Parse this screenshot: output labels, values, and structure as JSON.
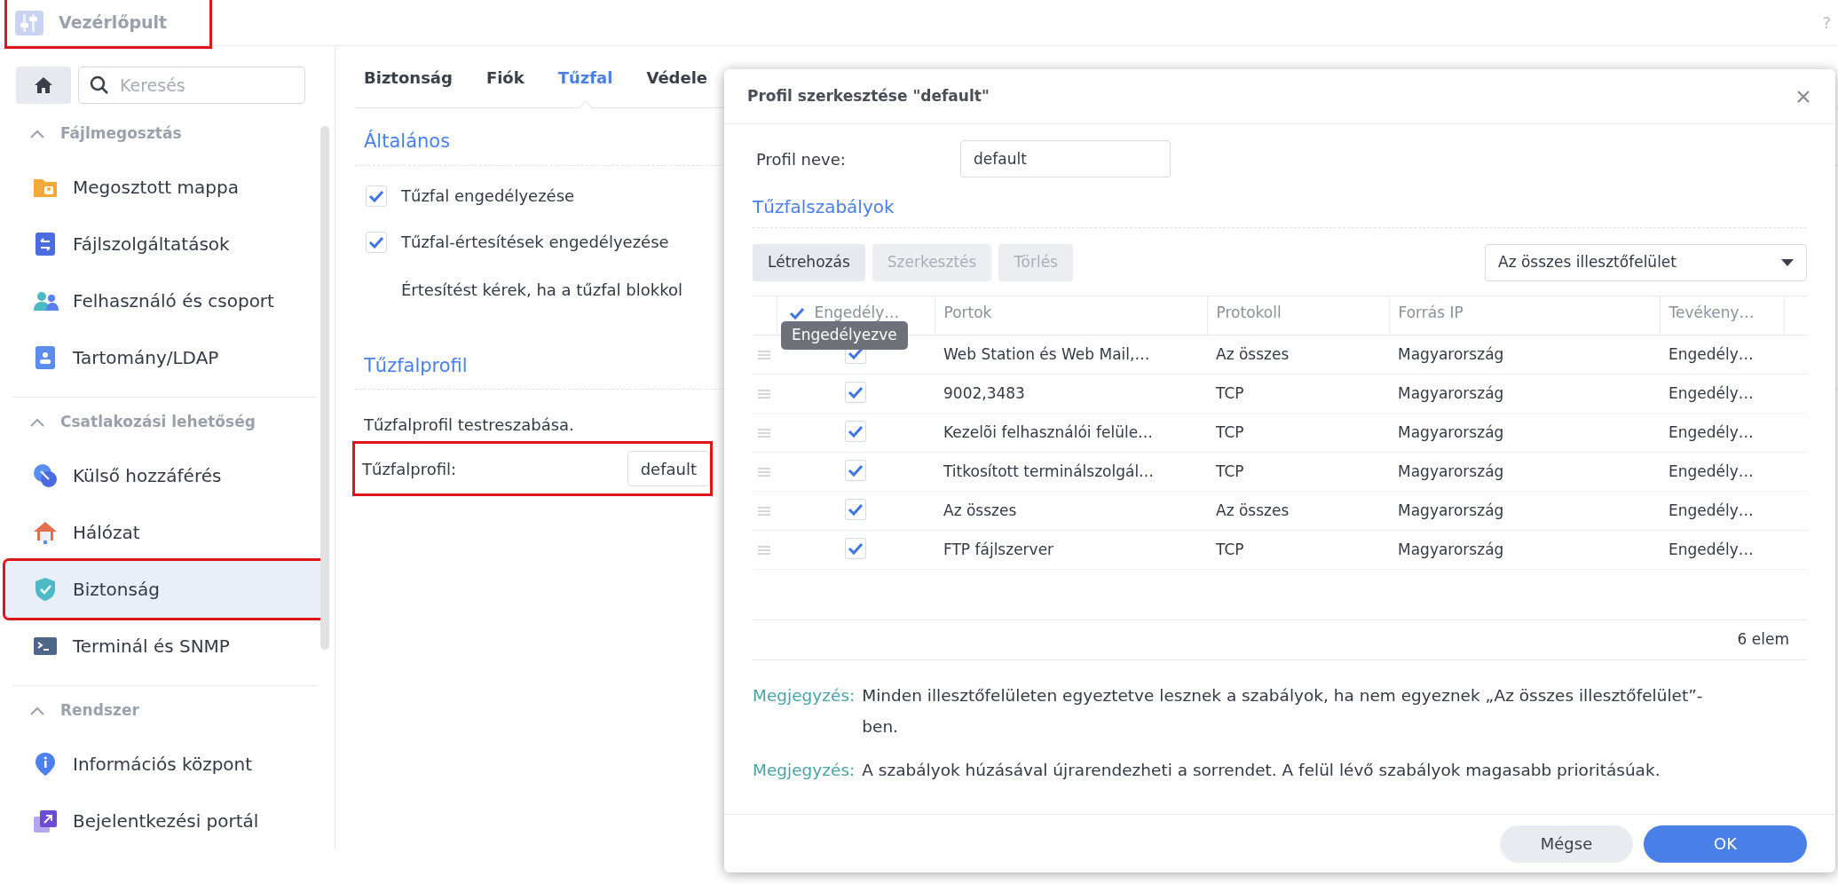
{
  "app": {
    "title": "Vezérlőpult",
    "highlight": true,
    "help": "?"
  },
  "sidebar": {
    "search": {
      "placeholder": "Keresés"
    },
    "groups": [
      {
        "label": "Fájlmegosztás",
        "expanded": true,
        "items": [
          {
            "label": "Megosztott mappa",
            "selected": false,
            "highlight": false
          },
          {
            "label": "Fájlszolgáltatások",
            "selected": false,
            "highlight": false
          },
          {
            "label": "Felhasználó és csoport",
            "selected": false,
            "highlight": false
          },
          {
            "label": "Tartomány/LDAP",
            "selected": false,
            "highlight": false
          }
        ]
      },
      {
        "label": "Csatlakozási lehetőség",
        "expanded": true,
        "items": [
          {
            "label": "Külső hozzáférés",
            "selected": false,
            "highlight": false
          },
          {
            "label": "Hálózat",
            "selected": false,
            "highlight": false
          },
          {
            "label": "Biztonság",
            "selected": true,
            "highlight": true
          },
          {
            "label": "Terminál és SNMP",
            "selected": false,
            "highlight": false
          }
        ]
      },
      {
        "label": "Rendszer",
        "expanded": true,
        "items": [
          {
            "label": "Információs központ",
            "selected": false,
            "highlight": false
          },
          {
            "label": "Bejelentkezési portál",
            "selected": false,
            "highlight": false
          }
        ]
      }
    ]
  },
  "main": {
    "tabs": [
      {
        "label": "Biztonság",
        "selected": false
      },
      {
        "label": "Fiók",
        "selected": false
      },
      {
        "label": "Tűzfal",
        "selected": true
      },
      {
        "label": "Védele",
        "selected": false
      }
    ],
    "general": {
      "title": "Általános",
      "options": [
        {
          "label": "Tűzfal engedélyezése",
          "checked": true
        },
        {
          "label": "Tűzfal-értesítések engedélyezése",
          "checked": true
        }
      ],
      "hint": "Értesítést kérek, ha a tűzfal blokkol"
    },
    "profile": {
      "title": "Tűzfalprofil",
      "description": "Tűzfalprofil testreszabása.",
      "label": "Tűzfalprofil:",
      "value": "default",
      "highlight": true
    }
  },
  "dialog": {
    "title": "Profil szerkesztése \"default\"",
    "profile_name": {
      "label": "Profil neve:",
      "value": "default"
    },
    "rules_title": "Tűzfalszabályok",
    "toolbar": [
      {
        "label": "Létrehozás",
        "disabled": false
      },
      {
        "label": "Szerkesztés",
        "disabled": true
      },
      {
        "label": "Törlés",
        "disabled": true
      }
    ],
    "interface_select": {
      "value": "Az összes illesztőfelület"
    },
    "table": {
      "header_checked": true,
      "columns": [
        "Engedély…",
        "Portok",
        "Protokoll",
        "Forrás IP",
        "Tevékeny…"
      ],
      "rows": [
        {
          "enabled": true,
          "ports": "Web Station és Web Mail,…",
          "protocol": "Az összes",
          "source_ip": "Magyarország",
          "action": "Engedély…"
        },
        {
          "enabled": true,
          "ports": "9002,3483",
          "protocol": "TCP",
          "source_ip": "Magyarország",
          "action": "Engedély…"
        },
        {
          "enabled": true,
          "ports": "Kezelõi felhasználói felüle…",
          "protocol": "TCP",
          "source_ip": "Magyarország",
          "action": "Engedély…"
        },
        {
          "enabled": true,
          "ports": "Titkosított terminálszolgál…",
          "protocol": "TCP",
          "source_ip": "Magyarország",
          "action": "Engedély…"
        },
        {
          "enabled": true,
          "ports": "Az összes",
          "protocol": "Az összes",
          "source_ip": "Magyarország",
          "action": "Engedély…"
        },
        {
          "enabled": true,
          "ports": "FTP fájlszerver",
          "protocol": "TCP",
          "source_ip": "Magyarország",
          "action": "Engedély…"
        }
      ],
      "tooltip": "Engedélyezve",
      "count": "6 elem"
    },
    "notes": [
      {
        "label": "Megjegyzés:",
        "text": "Minden illesztőfelületen egyeztetve lesznek a szabályok, ha nem egyeznek „Az összes illesztőfelület”-ben."
      },
      {
        "label": "Megjegyzés:",
        "text": "A szabályok húzásával újrarendezheti a sorrendet. A felül lévő szabályok magasabb prioritásúak."
      }
    ],
    "buttons": [
      {
        "label": "Mégse",
        "kind": "secondary"
      },
      {
        "label": "OK",
        "kind": "primary"
      }
    ]
  }
}
